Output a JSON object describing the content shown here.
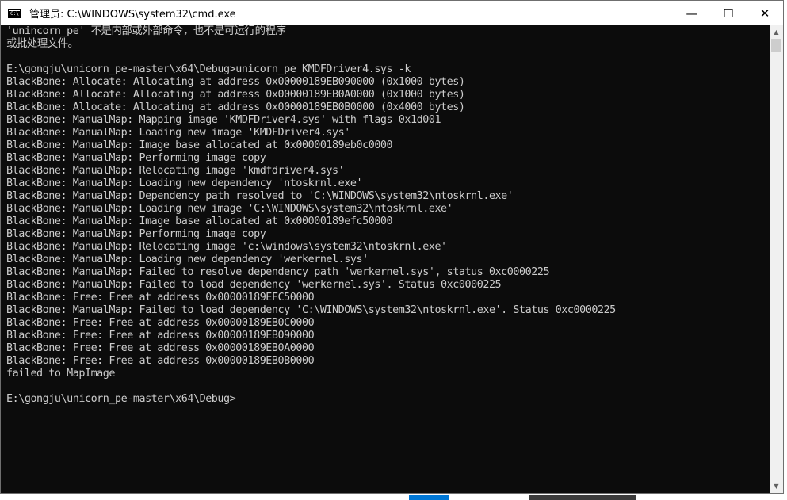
{
  "window": {
    "title": "管理员: C:\\WINDOWS\\system32\\cmd.exe",
    "icon": "cmd-icon",
    "icon_text": "C:\\",
    "buttons": {
      "minimize": "—",
      "maximize": "☐",
      "close": "✕"
    }
  },
  "colors": {
    "console_bg": "#0c0c0c",
    "console_text": "#cccccc",
    "titlebar_bg": "#ffffff",
    "scrollbar_bg": "#f0f0f0",
    "scrollbar_thumb": "#cdcdcd",
    "taskbar_accent": "#0078d7"
  },
  "console": {
    "lines": [
      "'unincorn_pe' 不是内部或外部命令，也不是可运行的程序",
      "或批处理文件。",
      "",
      "E:\\gongju\\unicorn_pe-master\\x64\\Debug>unicorn_pe KMDFDriver4.sys -k",
      "BlackBone: Allocate: Allocating at address 0x00000189EB090000 (0x1000 bytes)",
      "BlackBone: Allocate: Allocating at address 0x00000189EB0A0000 (0x1000 bytes)",
      "BlackBone: Allocate: Allocating at address 0x00000189EB0B0000 (0x4000 bytes)",
      "BlackBone: ManualMap: Mapping image 'KMDFDriver4.sys' with flags 0x1d001",
      "BlackBone: ManualMap: Loading new image 'KMDFDriver4.sys'",
      "BlackBone: ManualMap: Image base allocated at 0x00000189eb0c0000",
      "BlackBone: ManualMap: Performing image copy",
      "BlackBone: ManualMap: Relocating image 'kmdfdriver4.sys'",
      "BlackBone: ManualMap: Loading new dependency 'ntoskrnl.exe'",
      "BlackBone: ManualMap: Dependency path resolved to 'C:\\WINDOWS\\system32\\ntoskrnl.exe'",
      "BlackBone: ManualMap: Loading new image 'C:\\WINDOWS\\system32\\ntoskrnl.exe'",
      "BlackBone: ManualMap: Image base allocated at 0x00000189efc50000",
      "BlackBone: ManualMap: Performing image copy",
      "BlackBone: ManualMap: Relocating image 'c:\\windows\\system32\\ntoskrnl.exe'",
      "BlackBone: ManualMap: Loading new dependency 'werkernel.sys'",
      "BlackBone: ManualMap: Failed to resolve dependency path 'werkernel.sys', status 0xc0000225",
      "BlackBone: ManualMap: Failed to load dependency 'werkernel.sys'. Status 0xc0000225",
      "BlackBone: Free: Free at address 0x00000189EFC50000",
      "BlackBone: ManualMap: Failed to load dependency 'C:\\WINDOWS\\system32\\ntoskrnl.exe'. Status 0xc0000225",
      "BlackBone: Free: Free at address 0x00000189EB0C0000",
      "BlackBone: Free: Free at address 0x00000189EB090000",
      "BlackBone: Free: Free at address 0x00000189EB0A0000",
      "BlackBone: Free: Free at address 0x00000189EB0B0000",
      "failed to MapImage",
      "",
      "E:\\gongju\\unicorn_pe-master\\x64\\Debug>"
    ]
  }
}
